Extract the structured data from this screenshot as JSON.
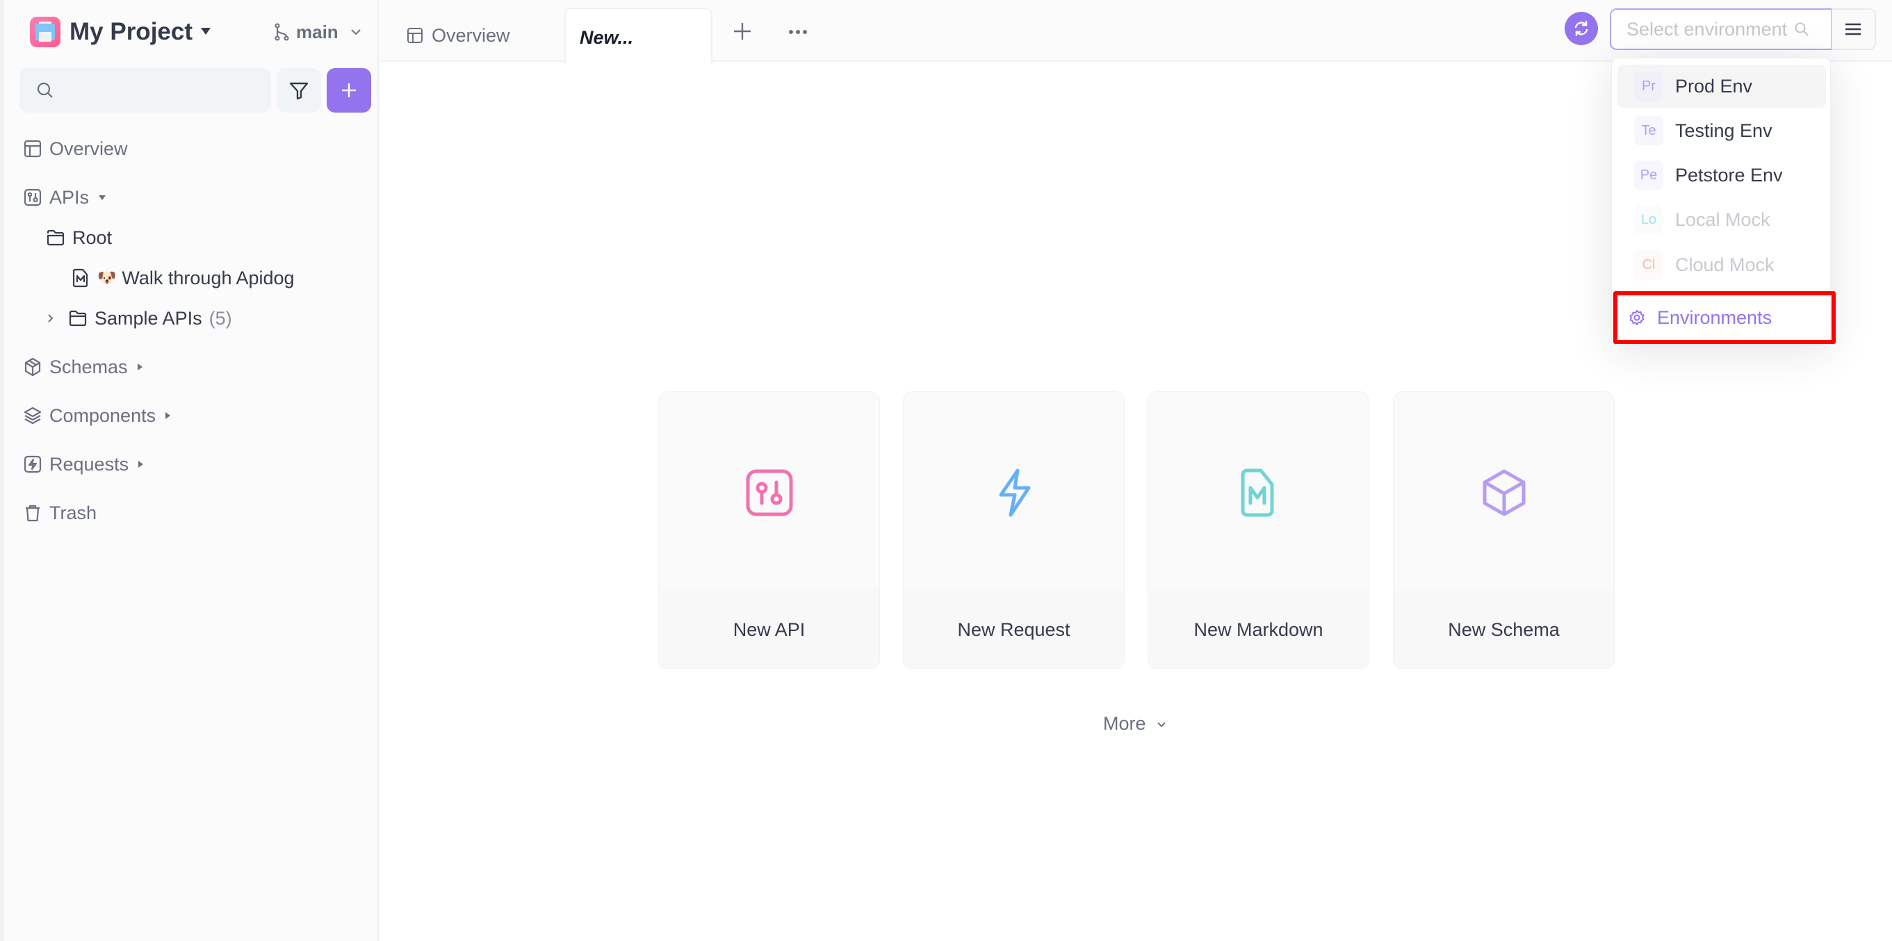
{
  "project": {
    "name": "My Project",
    "logo_icon": "printer-app-icon",
    "branch": "main"
  },
  "sidebar": {
    "search": {
      "placeholder": "",
      "value": ""
    },
    "items": [
      {
        "label": "Overview",
        "icon": "layout-icon"
      },
      {
        "label": "APIs",
        "icon": "api-icon",
        "expanded": true
      },
      {
        "label": "Root",
        "icon": "folder-open-icon"
      },
      {
        "label": "Walk through Apidog",
        "icon": "markdown-icon",
        "emoji": "🐶"
      },
      {
        "label": "Sample APIs",
        "icon": "folder-icon",
        "count": "(5)"
      },
      {
        "label": "Schemas",
        "icon": "cube-icon"
      },
      {
        "label": "Components",
        "icon": "layers-icon"
      },
      {
        "label": "Requests",
        "icon": "lightning-icon"
      },
      {
        "label": "Trash",
        "icon": "trash-icon"
      }
    ]
  },
  "tabs": [
    {
      "label": "Overview",
      "active": false
    },
    {
      "label": "New...",
      "active": true
    }
  ],
  "environment": {
    "placeholder": "Select environment",
    "options": [
      {
        "abbr": "Pr",
        "label": "Prod Env",
        "color": "#b79cf3",
        "bg": "#f1effa",
        "disabled": false,
        "highlighted": true
      },
      {
        "abbr": "Te",
        "label": "Testing Env",
        "color": "#b79cf3",
        "bg": "#f7f5fd",
        "disabled": false,
        "highlighted": false
      },
      {
        "abbr": "Pe",
        "label": "Petstore Env",
        "color": "#b79cf3",
        "bg": "#f7f5fd",
        "disabled": false,
        "highlighted": false
      },
      {
        "abbr": "Lo",
        "label": "Local Mock",
        "color": "#a7e3e6",
        "bg": "#fafbfb",
        "disabled": true,
        "highlighted": false
      },
      {
        "abbr": "Cl",
        "label": "Cloud Mock",
        "color": "#f7b8a4",
        "bg": "#fefafa",
        "disabled": true,
        "highlighted": false
      }
    ],
    "manage_label": "Environments"
  },
  "cards": [
    {
      "label": "New API",
      "icon": "api-icon",
      "color": "#f272b0"
    },
    {
      "label": "New Request",
      "icon": "lightning-icon",
      "color": "#66b0f8"
    },
    {
      "label": "New Markdown",
      "icon": "markdown-icon",
      "color": "#6fd4d4"
    },
    {
      "label": "New Schema",
      "icon": "cube-icon",
      "color": "#b79cf3"
    }
  ],
  "more_label": "More",
  "colors": {
    "accent": "#9373ee",
    "highlight_box": "#ff0000"
  }
}
